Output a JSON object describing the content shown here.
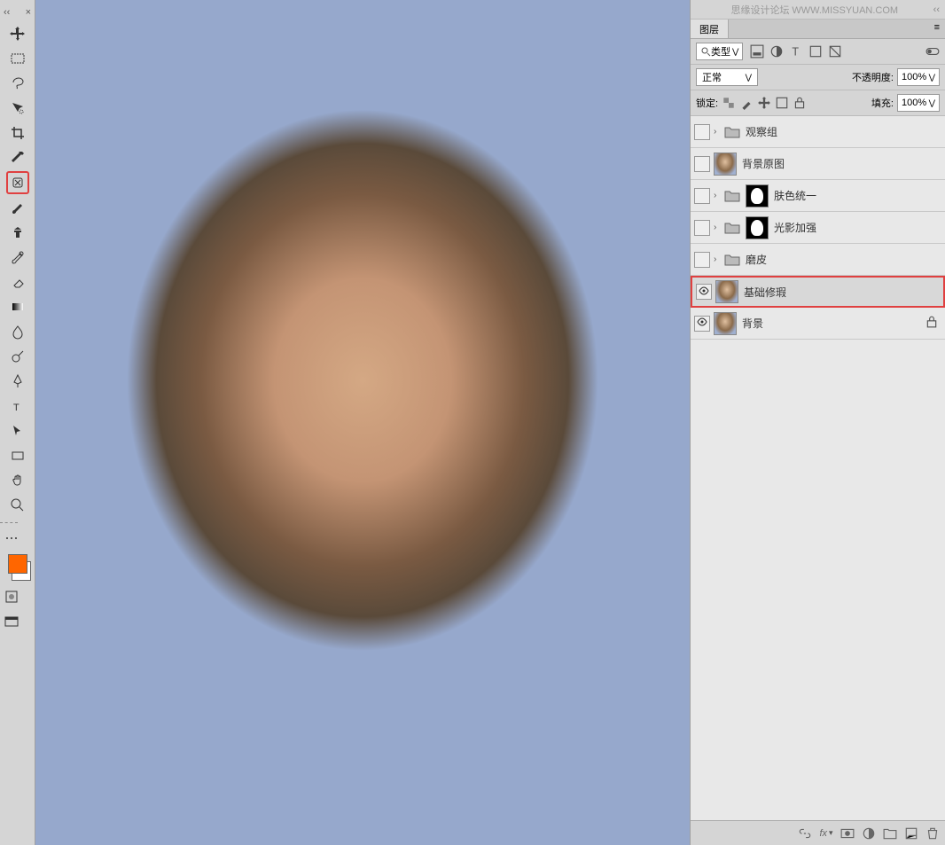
{
  "topbar": {
    "watermark_text": "思缘设计论坛",
    "watermark_url": "WWW.MISSYUAN.COM",
    "collapse_label": "‹‹"
  },
  "toolbar": {
    "tools": [
      "move",
      "rectangular-marquee",
      "lasso",
      "quick-selection",
      "crop",
      "eyedropper",
      "spot-healing",
      "brush",
      "clone-stamp",
      "history-brush",
      "eraser",
      "gradient",
      "blur",
      "dodge",
      "pen",
      "type",
      "path-selection",
      "rectangle",
      "hand",
      "zoom"
    ],
    "selected_tool_index": 6
  },
  "colors": {
    "foreground": "#ff6600",
    "background": "#ffffff"
  },
  "layers_panel": {
    "tab_label": "图层",
    "filter": {
      "label": "类型"
    },
    "blend_mode": {
      "label": "正常"
    },
    "opacity": {
      "label": "不透明度:",
      "value": "100%"
    },
    "lock": {
      "label": "锁定:"
    },
    "fill": {
      "label": "填充:",
      "value": "100%"
    },
    "layers": [
      {
        "name": "观察组",
        "type": "group",
        "visible": false
      },
      {
        "name": "背景原图",
        "type": "image",
        "visible": false
      },
      {
        "name": "肤色统一",
        "type": "group-mask",
        "visible": false
      },
      {
        "name": "光影加强",
        "type": "group-mask",
        "visible": false
      },
      {
        "name": "磨皮",
        "type": "group",
        "visible": false
      },
      {
        "name": "基础修瑕",
        "type": "image",
        "visible": true,
        "selected": true
      },
      {
        "name": "背景",
        "type": "image",
        "visible": true,
        "locked": true
      }
    ]
  }
}
